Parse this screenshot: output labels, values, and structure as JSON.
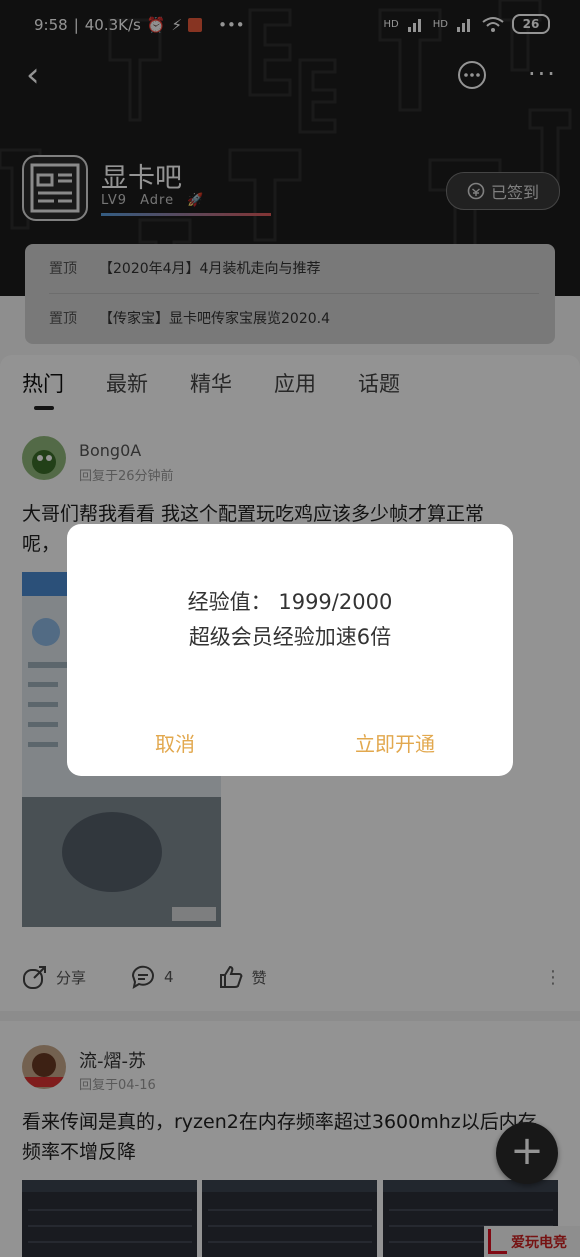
{
  "status_bar": {
    "time": "9:58",
    "speed": "40.3K/s",
    "net1": "HD",
    "net2": "HD",
    "more": "•••",
    "battery": "26"
  },
  "header": {
    "forum_name": "显卡吧",
    "level": "LV9",
    "level_title": "Adre",
    "level_progress": 0.9995,
    "signed_label": "已签到"
  },
  "pinned": [
    {
      "tag": "置顶",
      "title": "【2020年4月】4月装机走向与推荐"
    },
    {
      "tag": "置顶",
      "title": "【传家宝】显卡吧传家宝展览2020.4"
    }
  ],
  "tabs": [
    "热门",
    "最新",
    "精华",
    "应用",
    "话题"
  ],
  "posts": [
    {
      "user": "Bong0A",
      "time": "回复于26分钟前",
      "text_line1": "大哥们帮我看看 我这个配置玩吃鸡应该多少帧才算正常",
      "text_line2": "呢，",
      "actions": {
        "share": "分享",
        "comments": "4",
        "like": "赞"
      }
    },
    {
      "user": "流-熠-苏",
      "time": "回复于04-16",
      "text": "看来传闻是真的，ryzen2在内存频率超过3600mhz以后内存频率不增反降"
    }
  ],
  "dialog": {
    "line1": "经验值：  1999/2000",
    "line2": "超级会员经验加速6倍",
    "cancel": "取消",
    "confirm": "立即开通"
  },
  "watermark": "爱玩电竞",
  "colors": {
    "accent": "#e2a84e",
    "header_bg": "#1c1c1c",
    "overlay": "rgba(0,0,0,0.42)"
  },
  "icons": [
    "back-icon",
    "message-icon",
    "more-icon",
    "checkin-icon",
    "rocket-icon",
    "share-icon",
    "comment-icon",
    "like-icon",
    "plus-icon"
  ]
}
